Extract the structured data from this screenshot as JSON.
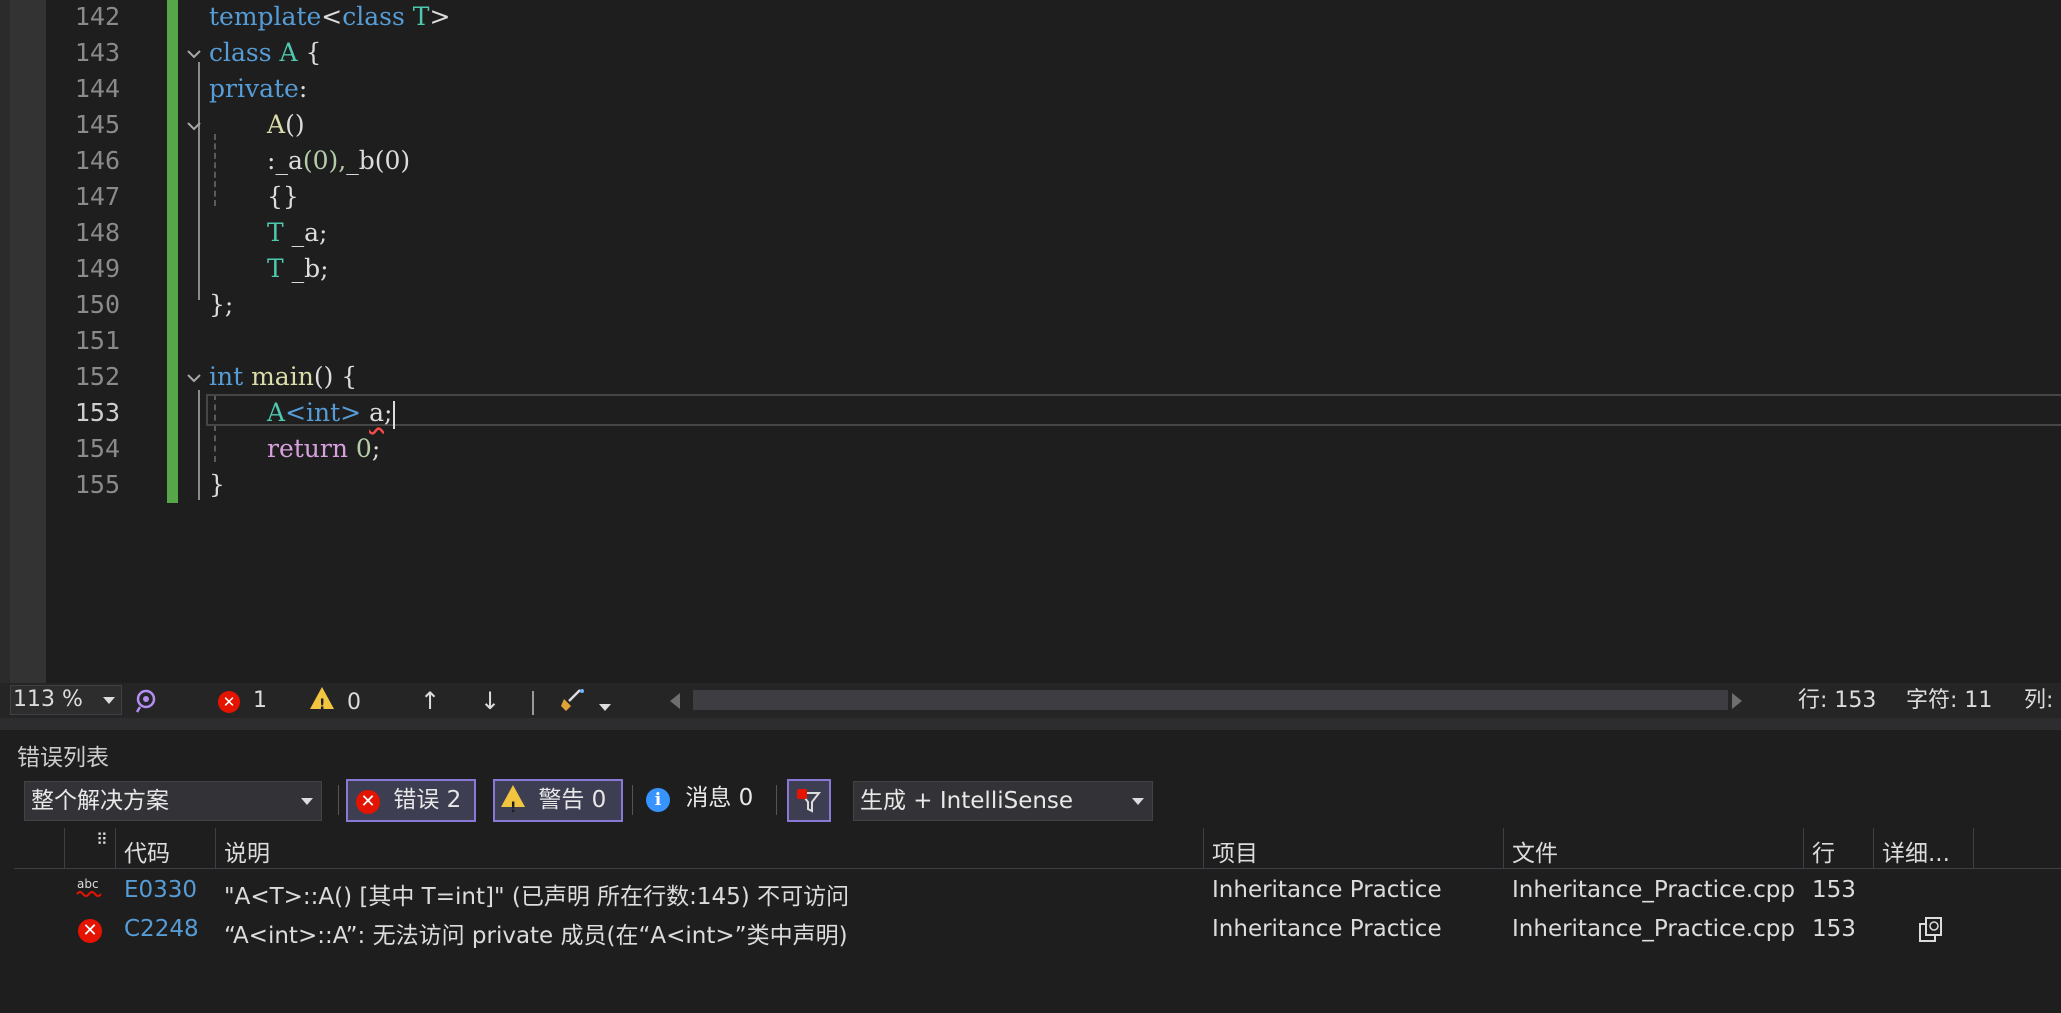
{
  "editor": {
    "lines": [
      {
        "num": "142"
      },
      {
        "num": "143"
      },
      {
        "num": "144"
      },
      {
        "num": "145"
      },
      {
        "num": "146"
      },
      {
        "num": "147"
      },
      {
        "num": "148"
      },
      {
        "num": "149"
      },
      {
        "num": "150"
      },
      {
        "num": "151"
      },
      {
        "num": "152"
      },
      {
        "num": "153"
      },
      {
        "num": "154"
      },
      {
        "num": "155"
      }
    ],
    "tokens": {
      "template": "template",
      "lt": "<",
      "class": "class",
      "T": " T",
      "gt": ">",
      "class2": "class",
      "A": " A",
      "brace_open": " {",
      "private": "private",
      "colon": ":",
      "ctor_name": "A",
      "ctor_parens": "()",
      "init_colon": ":",
      "init_a": "_a",
      "init_a_arg": "(0),",
      "init_b": "_b",
      "init_b_arg": "(0)",
      "empty_body": "{}",
      "type_T": "T",
      "member_a": " _a;",
      "type_T2": "T",
      "member_b": " _b;",
      "class_close": "};",
      "int": "int",
      "main": " main",
      "main_rest": "() {",
      "A_type": "A",
      "template_arg": "<int>",
      "var_a": "a",
      "semicolon": ";",
      "return": "return",
      "zero": " 0",
      "semi2": ";",
      "main_close": "}"
    }
  },
  "editor_bar": {
    "zoom": "113 %",
    "error_count": "1",
    "warning_count": "0",
    "line_label": "行: 153",
    "char_label": "字符: 11",
    "col_label": "列:"
  },
  "error_list": {
    "title": "错误列表",
    "scope": "整个解决方案",
    "errors_btn": "错误 2",
    "warnings_btn": "警告 0",
    "messages_btn": "消息 0",
    "source": "生成 + IntelliSense",
    "columns": {
      "code": "代码",
      "description": "说明",
      "project": "项目",
      "file": "文件",
      "line": "行",
      "details": "详细..."
    },
    "rows": [
      {
        "type_icon": "spell-check-icon",
        "code": "E0330",
        "description": "\"A<T>::A() [其中 T=int]\" (已声明 所在行数:145) 不可访问",
        "project": "Inheritance Practice",
        "file": "Inheritance_Practice.cpp",
        "line": "153"
      },
      {
        "type_icon": "error-icon",
        "code": "C2248",
        "description": "“A<int>::A”: 无法访问 private 成员(在“A<int>”类中声明)",
        "project": "Inheritance Practice",
        "file": "Inheritance_Practice.cpp",
        "line": "153"
      }
    ]
  },
  "colors": {
    "background": "#1e1e1e",
    "change_bar": "#57a64a",
    "keyword": "#569cd6",
    "type": "#4ec9b0",
    "function": "#dcdcaa",
    "number": "#b5cea8",
    "error_red": "#e51400",
    "toggle_border": "#8a78d6"
  }
}
